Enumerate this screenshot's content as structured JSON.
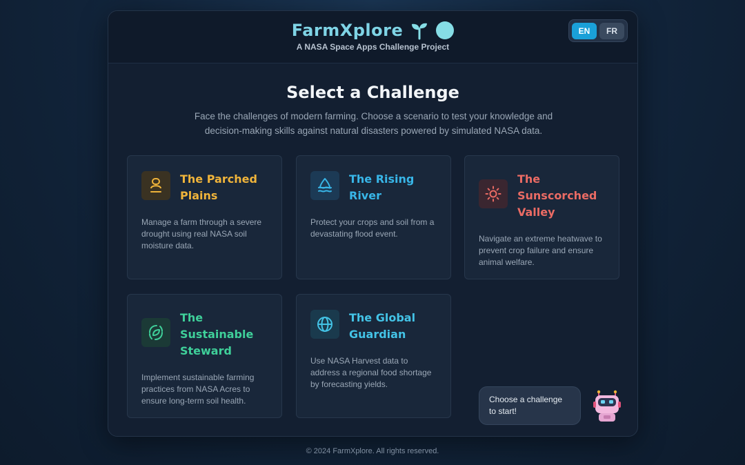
{
  "header": {
    "brand_title": "FarmXplore",
    "brand_subtitle": "A NASA Space Apps Challenge Project",
    "languages": {
      "en": "EN",
      "fr": "FR"
    },
    "active_language": "EN"
  },
  "main": {
    "title": "Select a Challenge",
    "description": "Face the challenges of modern farming. Choose a scenario to test your knowledge and decision-making skills against natural disasters powered by simulated NASA data.",
    "cards": [
      {
        "title": "The Parched Plains",
        "description": "Manage a farm through a severe drought using real NASA soil moisture data.",
        "icon": "drought-icon",
        "color": "#f0b43a"
      },
      {
        "title": "The Rising River",
        "description": "Protect your crops and soil from a devastating flood event.",
        "icon": "flood-icon",
        "color": "#38b6e8"
      },
      {
        "title": "The Sunscorched Valley",
        "description": "Navigate an extreme heatwave to prevent crop failure and ensure animal welfare.",
        "icon": "sun-icon",
        "color": "#ea6b64"
      },
      {
        "title": "The Sustainable Steward",
        "description": "Implement sustainable farming practices from NASA Acres to ensure long-term soil health.",
        "icon": "recycle-leaf-icon",
        "color": "#3fd09a"
      },
      {
        "title": "The Global Guardian",
        "description": "Use NASA Harvest data to address a regional food shortage by forecasting yields.",
        "icon": "globe-icon",
        "color": "#43c3e6"
      }
    ]
  },
  "assistant": {
    "message": "Choose a challenge to start!",
    "icon": "robot-icon"
  },
  "footer": {
    "copyright": "© 2024 FarmXplore. All rights reserved."
  }
}
